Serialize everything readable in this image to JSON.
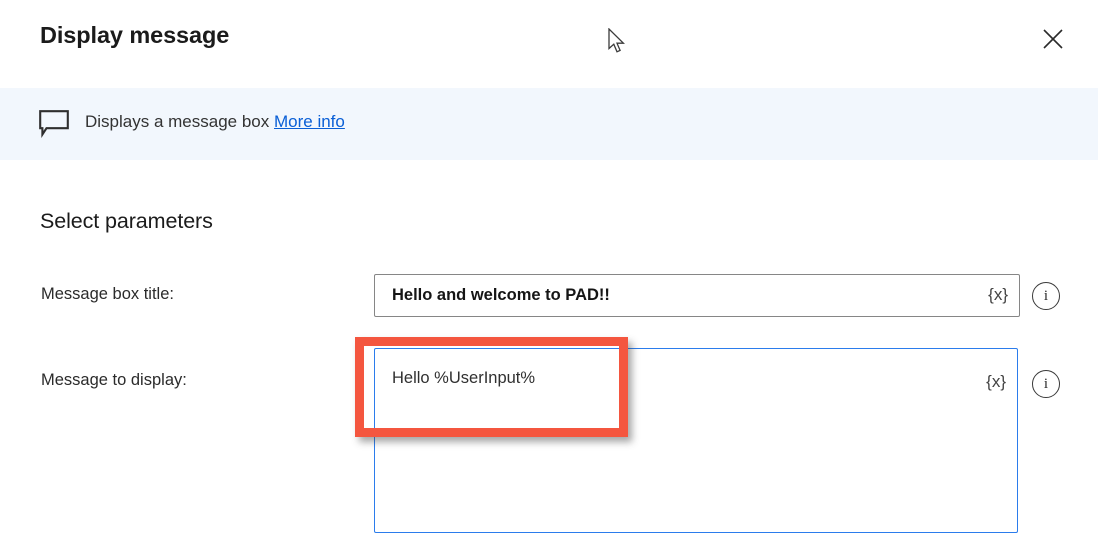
{
  "dialog": {
    "title": "Display message",
    "close_label": "Close",
    "close_icon": "close-icon"
  },
  "banner": {
    "icon": "speech-bubble-icon",
    "text": "Displays a message box",
    "link_label": "More info",
    "background_color": "#f2f7fd",
    "link_color": "#0a5fd6"
  },
  "parameters": {
    "heading": "Select parameters",
    "fields": [
      {
        "label": "Message box title:",
        "value": "Hello and welcome to PAD!!",
        "variable_glyph": "{x}",
        "info_icon": "info-circle-icon",
        "type": "text"
      },
      {
        "label": "Message to display:",
        "value": "Hello %UserInput%",
        "variable_glyph": "{x}",
        "info_icon": "info-circle-icon",
        "type": "textarea",
        "focused": true
      }
    ]
  },
  "annotation": {
    "shape": "rectangle",
    "color": "#f4563f",
    "target": "Message to display: value"
  },
  "cursor": {
    "icon": "arrow-pointer-icon"
  }
}
